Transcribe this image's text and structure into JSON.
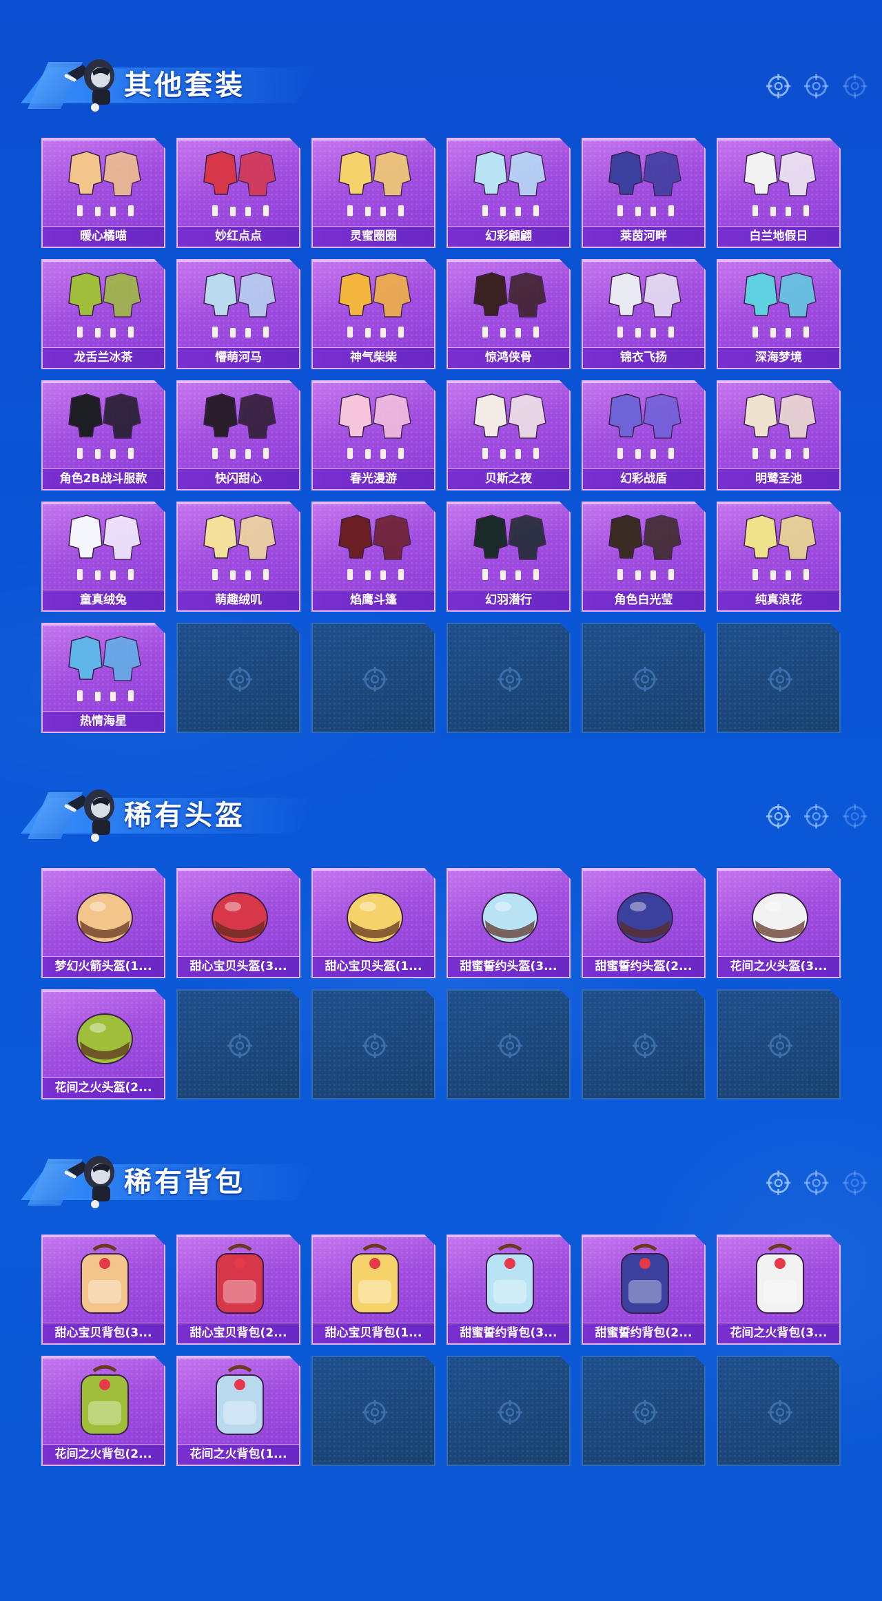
{
  "sections": [
    {
      "id": "suits",
      "title": "其他套装",
      "items": [
        "暖心橘喵",
        "妙红点点",
        "灵蜜圈圈",
        "幻彩翩翩",
        "莱茵河畔",
        "白兰地假日",
        "龙舌兰冰茶",
        "懵萌河马",
        "神气柴柴",
        "惊鸿侠骨",
        "锦衣飞扬",
        "深海梦境",
        "角色2B战斗服款",
        "快闪甜心",
        "春光漫游",
        "贝斯之夜",
        "幻彩战盾",
        "明鹭圣池",
        "童真绒兔",
        "萌趣绒叽",
        "焰鹰斗篷",
        "幻羽潜行",
        "角色白光莹",
        "纯真浪花",
        "热情海星"
      ],
      "empty_slots": 5
    },
    {
      "id": "helmets",
      "title": "稀有头盔",
      "items": [
        "梦幻火箭头盔(1...",
        "甜心宝贝头盔(3...",
        "甜心宝贝头盔(1...",
        "甜蜜誓约头盔(3...",
        "甜蜜誓约头盔(2...",
        "花间之火头盔(3...",
        "花间之火头盔(2..."
      ],
      "empty_slots": 5
    },
    {
      "id": "backpacks",
      "title": "稀有背包",
      "items": [
        "甜心宝贝背包(3...",
        "甜心宝贝背包(2...",
        "甜心宝贝背包(1...",
        "甜蜜誓约背包(3...",
        "甜蜜誓约背包(2...",
        "花间之火背包(3...",
        "花间之火背包(2...",
        "花间之火背包(1..."
      ],
      "empty_slots": 4
    }
  ],
  "colors": {
    "background": "#0a56d6",
    "card_filled": "#a24fe0",
    "card_label": "#7a2fd0",
    "card_empty": "#1f4f8c",
    "title_text": "#ffffff"
  },
  "icons": {
    "section_header_art": "character-avatar-icon",
    "header_decoration": "crosshair-target-icon",
    "empty_slot": "crosshair-target-icon"
  }
}
